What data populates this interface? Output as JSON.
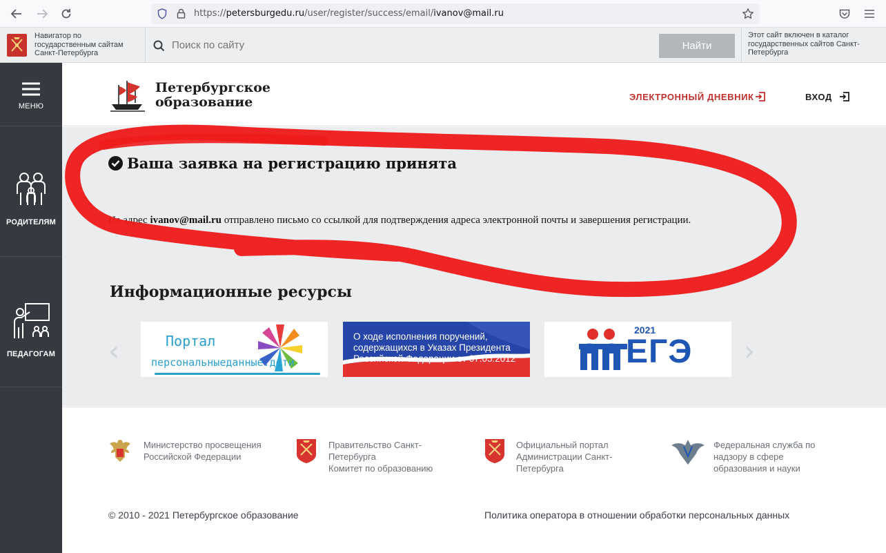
{
  "browser": {
    "url_prefix": "https://",
    "url_domain": "petersburgedu.ru",
    "url_path": "/user/register/success/email/",
    "url_email": "ivanov@mail.ru"
  },
  "gov_bar": {
    "navigator_text": "Навигатор по государственным сайтам Санкт-Петербурга",
    "search_placeholder": "Поиск по сайту",
    "search_button": "Найти",
    "catalog_text": "Этот сайт включен в каталог государственных сайтов Санкт-Петербурга"
  },
  "sidebar": {
    "menu": "МЕНЮ",
    "parents": "РОДИТЕЛЯМ",
    "teachers": "ПЕДАГОГАМ"
  },
  "header": {
    "logo_line1": "Петербургское",
    "logo_line2": "образование",
    "diary": "ЭЛЕКТРОННЫЙ ДНЕВНИК",
    "login": "ВХОД"
  },
  "main": {
    "success_title": "Ваша заявка на регистрацию принята",
    "msg_before": "На адрес ",
    "msg_email": "ivanov@mail.ru",
    "msg_after": " отправлено письмо со ссылкой для подтверждения адреса электронной почты и завершения регистрации.",
    "resources_title": "Информационные ресурсы"
  },
  "banners": {
    "portal_line1": "Портал",
    "portal_line2": "персональныеданные.дети",
    "decree_line1": "О ходе исполнения поручений,",
    "decree_line2": "содержащихся в Указах Президента",
    "decree_line3": "Российской Федерации от 07.05.2012",
    "ege_year": "2021",
    "ege_text": "ЕГЭ"
  },
  "footer": {
    "link1": "Министерство просвещения Российской Федерации",
    "link2_line1": "Правительство Санкт-Петербурга",
    "link2_line2": "Комитет по образованию",
    "link3": "Официальный портал Администрации Санкт-Петербурга",
    "link4": "Федеральная служба по надзору в сфере образования и науки",
    "copyright": "© 2010 - 2021 Петербургское образование",
    "policy": "Политика оператора в отношении обработки персональных данных"
  },
  "colors": {
    "accent_red": "#c0302c",
    "sidebar_bg": "#363a40",
    "main_bg": "#ebecee",
    "annotation_red": "#ee1c1c"
  }
}
